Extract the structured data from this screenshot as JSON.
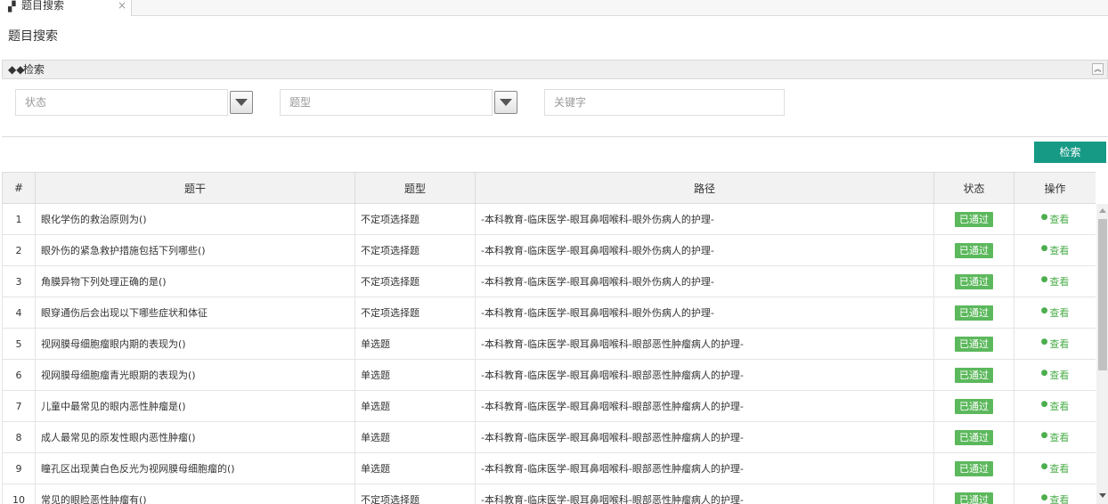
{
  "tab": {
    "icon": "building-icon",
    "label": "题目搜索",
    "close": "×"
  },
  "page": {
    "title": "题目搜索"
  },
  "panel": {
    "title": "检索",
    "icon": "binoculars-icon",
    "collapse_glyph": "︽"
  },
  "filters": {
    "status_placeholder": "状态",
    "type_placeholder": "题型",
    "keyword_placeholder": "关键字"
  },
  "search_button": "检索",
  "table": {
    "columns": [
      "#",
      "题干",
      "题型",
      "路径",
      "状态",
      "操作"
    ],
    "rows": [
      {
        "num": "1",
        "stem": "眼化学伤的救治原则为()",
        "type": "不定项选择题",
        "path": "-本科教育-临床医学-眼耳鼻咽喉科-眼外伤病人的护理-",
        "status": "已通过",
        "action": "查看"
      },
      {
        "num": "2",
        "stem": "眼外伤的紧急救护措施包括下列哪些()",
        "type": "不定项选择题",
        "path": "-本科教育-临床医学-眼耳鼻咽喉科-眼外伤病人的护理-",
        "status": "已通过",
        "action": "查看"
      },
      {
        "num": "3",
        "stem": "角膜异物下列处理正确的是()",
        "type": "不定项选择题",
        "path": "-本科教育-临床医学-眼耳鼻咽喉科-眼外伤病人的护理-",
        "status": "已通过",
        "action": "查看"
      },
      {
        "num": "4",
        "stem": "眼穿通伤后会出现以下哪些症状和体征",
        "type": "不定项选择题",
        "path": "-本科教育-临床医学-眼耳鼻咽喉科-眼外伤病人的护理-",
        "status": "已通过",
        "action": "查看"
      },
      {
        "num": "5",
        "stem": "视网膜母细胞瘤眼内期的表现为()",
        "type": "单选题",
        "path": "-本科教育-临床医学-眼耳鼻咽喉科-眼部恶性肿瘤病人的护理-",
        "status": "已通过",
        "action": "查看"
      },
      {
        "num": "6",
        "stem": "视网膜母细胞瘤青光眼期的表现为()",
        "type": "单选题",
        "path": "-本科教育-临床医学-眼耳鼻咽喉科-眼部恶性肿瘤病人的护理-",
        "status": "已通过",
        "action": "查看"
      },
      {
        "num": "7",
        "stem": "儿童中最常见的眼内恶性肿瘤是()",
        "type": "单选题",
        "path": "-本科教育-临床医学-眼耳鼻咽喉科-眼部恶性肿瘤病人的护理-",
        "status": "已通过",
        "action": "查看"
      },
      {
        "num": "8",
        "stem": "成人最常见的原发性眼内恶性肿瘤()",
        "type": "单选题",
        "path": "-本科教育-临床医学-眼耳鼻咽喉科-眼部恶性肿瘤病人的护理-",
        "status": "已通过",
        "action": "查看"
      },
      {
        "num": "9",
        "stem": "瞳孔区出现黄白色反光为视网膜母细胞瘤的()",
        "type": "单选题",
        "path": "-本科教育-临床医学-眼耳鼻咽喉科-眼部恶性肿瘤病人的护理-",
        "status": "已通过",
        "action": "查看"
      },
      {
        "num": "10",
        "stem": "常见的眼睑恶性肿瘤有()",
        "type": "不定项选择题",
        "path": "-本科教育-临床医学-眼耳鼻咽喉科-眼部恶性肿瘤病人的护理-",
        "status": "已通过",
        "action": "查看"
      }
    ]
  },
  "colors": {
    "primary_button": "#169a86",
    "status_badge": "#5cb85c",
    "view_link": "#4cae4c"
  }
}
